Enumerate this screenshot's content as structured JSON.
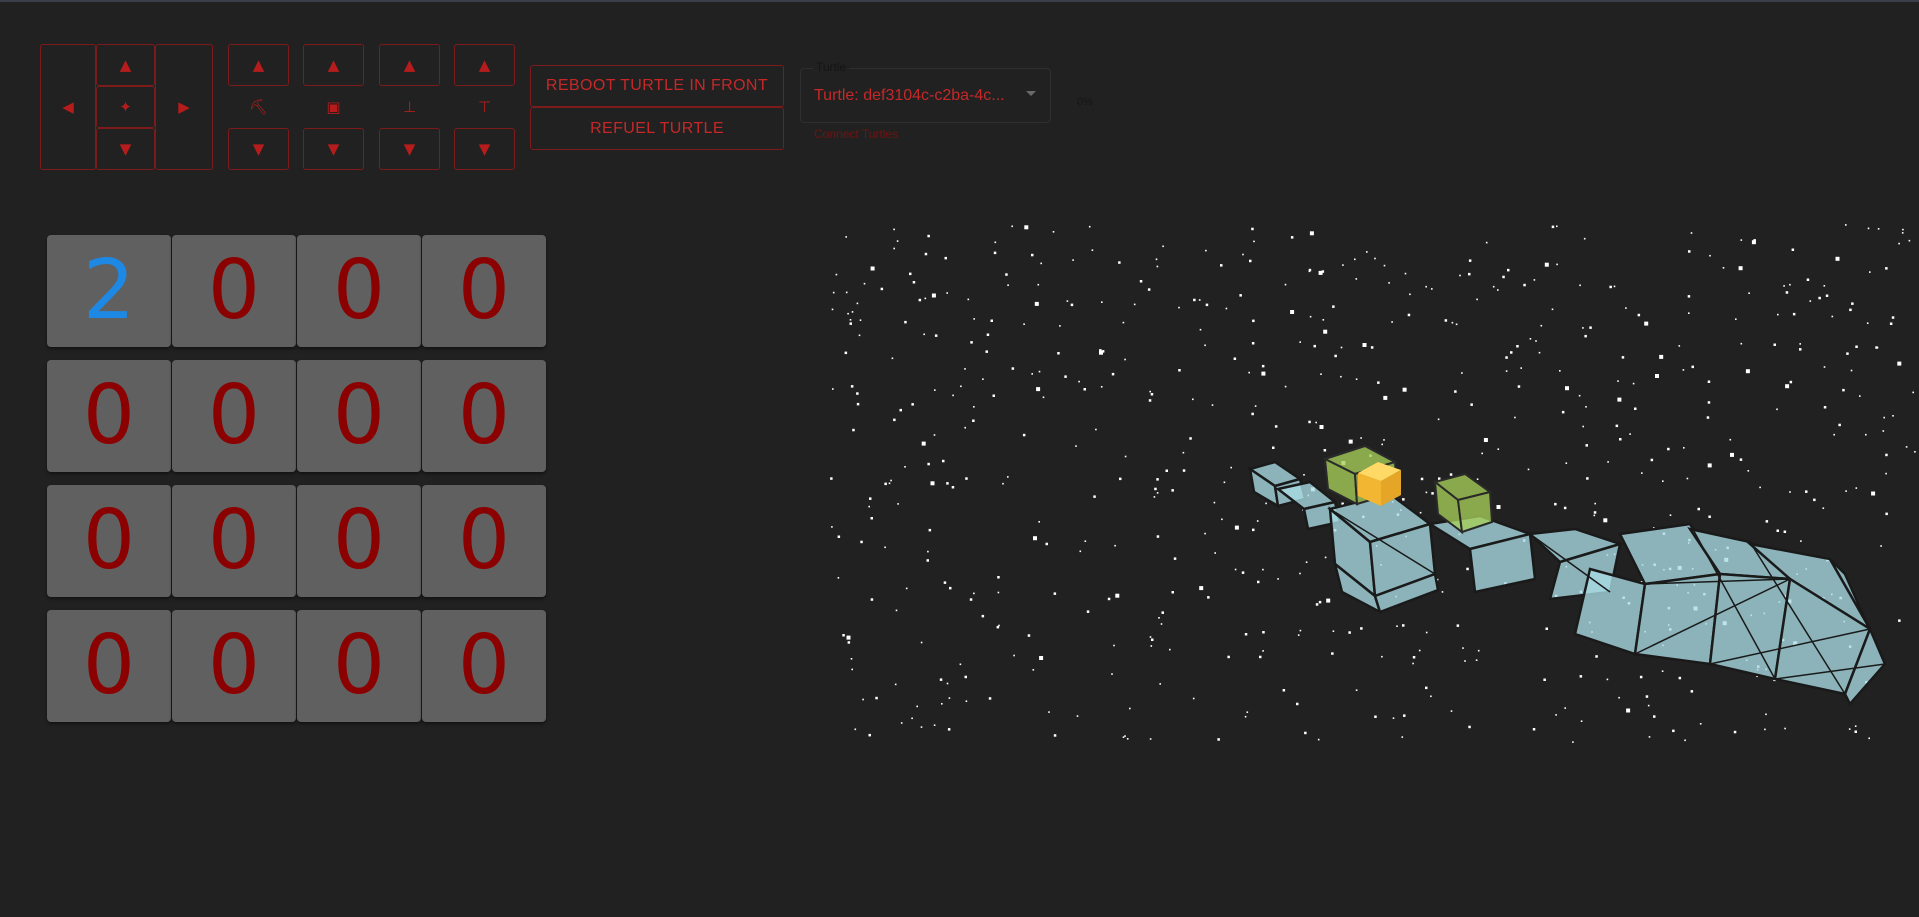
{
  "controls": {
    "move": {
      "left": "◀",
      "up": "▲",
      "center": "✦",
      "down": "▼",
      "right": "▶"
    },
    "actions": [
      {
        "name": "dig",
        "up": "▲",
        "icon": "⛏",
        "down": "▼",
        "icon_name": "pickaxe-icon"
      },
      {
        "name": "place",
        "up": "▲",
        "icon": "▣",
        "down": "▼",
        "icon_name": "place-block-icon"
      },
      {
        "name": "drop",
        "up": "▲",
        "icon": "⊥",
        "down": "▼",
        "icon_name": "drop-icon"
      },
      {
        "name": "suck",
        "up": "▲",
        "icon": "⊤",
        "down": "▼",
        "icon_name": "suck-icon"
      }
    ]
  },
  "buttons": {
    "reboot": "REBOOT TURTLE IN FRONT",
    "refuel": "REFUEL TURTLE"
  },
  "turtle_select": {
    "label": "Turtle",
    "value": "Turtle: def3104c-c2ba-4c...",
    "helper": "Connect Turtles"
  },
  "progress_text": "0%",
  "inventory": {
    "selected_index": 0,
    "slots": [
      "2",
      "0",
      "0",
      "0",
      "0",
      "0",
      "0",
      "0",
      "0",
      "0",
      "0",
      "0",
      "0",
      "0",
      "0",
      "0"
    ]
  },
  "colors": {
    "background": "#212121",
    "accent_red": "#c62828",
    "slot_bg": "#606060",
    "slot_count": "#8b0000",
    "slot_selected": "#1e88e5",
    "block_glass": "#a9dde4",
    "block_leaves": "#a6cf58",
    "turtle": "#f7c343"
  }
}
